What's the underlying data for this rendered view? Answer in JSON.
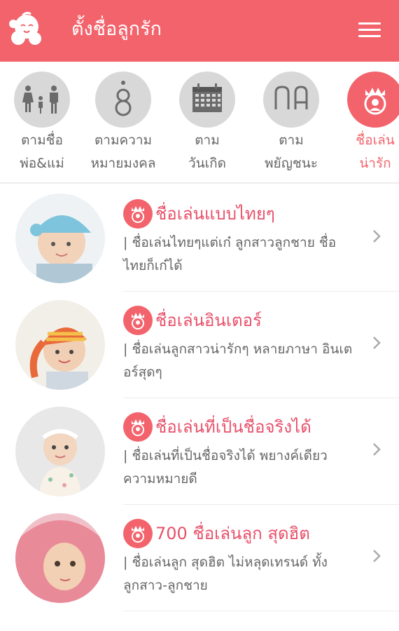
{
  "header": {
    "title": "ตั้งชื่อลูกรัก",
    "logo_icon": "baby-logo-icon",
    "menu_icon": "hamburger-menu-icon",
    "bg_color": "#f2636c"
  },
  "categories": [
    {
      "label": "ตามชื่อ\nพ่อ&แม่",
      "icon": "family-icon",
      "active": false
    },
    {
      "label": "ตามความ\nหมายมงคล",
      "icon": "lucky-number-8-icon",
      "active": false
    },
    {
      "label": "ตาม\nวันเกิด",
      "icon": "calendar-icon",
      "active": false
    },
    {
      "label": "ตาม\nพยัญชนะ",
      "icon": "thai-letters-icon",
      "active": false
    },
    {
      "label": "ชื่อเล่น\nน่ารัก",
      "icon": "crowned-baby-icon",
      "active": true
    }
  ],
  "items": [
    {
      "title": "ชื่อเล่นแบบไทยๆ",
      "description": "| ชื่อเล่นไทยๆแต่เก๋ ลูกสาวลูกชาย ชื่อไทยก็เก๋ได้",
      "image": "baby-blue-hat-photo"
    },
    {
      "title": "ชื่อเล่นอินเตอร์",
      "description": "| ชื่อเล่นลูกสาวน่ารักๆ หลายภาษา อินเตอร์สุดๆ",
      "image": "baby-striped-hat-photo"
    },
    {
      "title": "ชื่อเล่นที่เป็นชื่อจริงได้",
      "description": "| ชื่อเล่นที่เป็นชื่อจริงได้ พยางค์เดียว ความหมายดี",
      "image": "baby-headband-photo"
    },
    {
      "title": "700 ชื่อเล่นลูก สุดฮิต",
      "description": "| ชื่อเล่นลูก สุดฮิต ไม่หลุดเทรนด์ ทั้งลูกสาว-ลูกชาย",
      "image": "baby-pink-towel-photo"
    }
  ],
  "colors": {
    "accent": "#f2636c",
    "title_pink": "#e8506a",
    "icon_gray": "#d8d8d8"
  }
}
